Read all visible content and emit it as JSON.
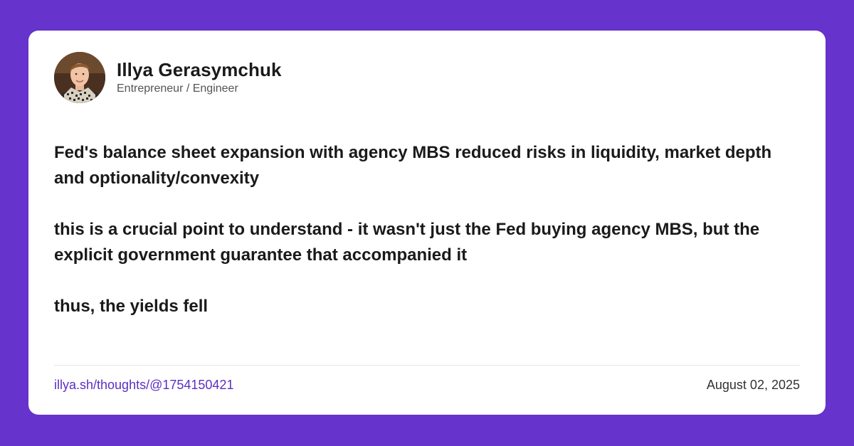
{
  "colors": {
    "background": "#6633CC",
    "card": "#FFFFFF",
    "link": "#5B2EC2"
  },
  "author": {
    "name": "Illya Gerasymchuk",
    "role": "Entrepreneur / Engineer",
    "avatar_icon": "profile-photo"
  },
  "post": {
    "paragraphs": [
      "Fed's balance sheet expansion with agency MBS reduced risks in liquidity, market depth and optionality/convexity",
      "this is a crucial point to understand - it wasn't just the Fed buying agency MBS, but the explicit government guarantee that accompanied it",
      "thus, the yields fell"
    ]
  },
  "footer": {
    "permalink": "illya.sh/thoughts/@1754150421",
    "date": "August 02, 2025"
  }
}
